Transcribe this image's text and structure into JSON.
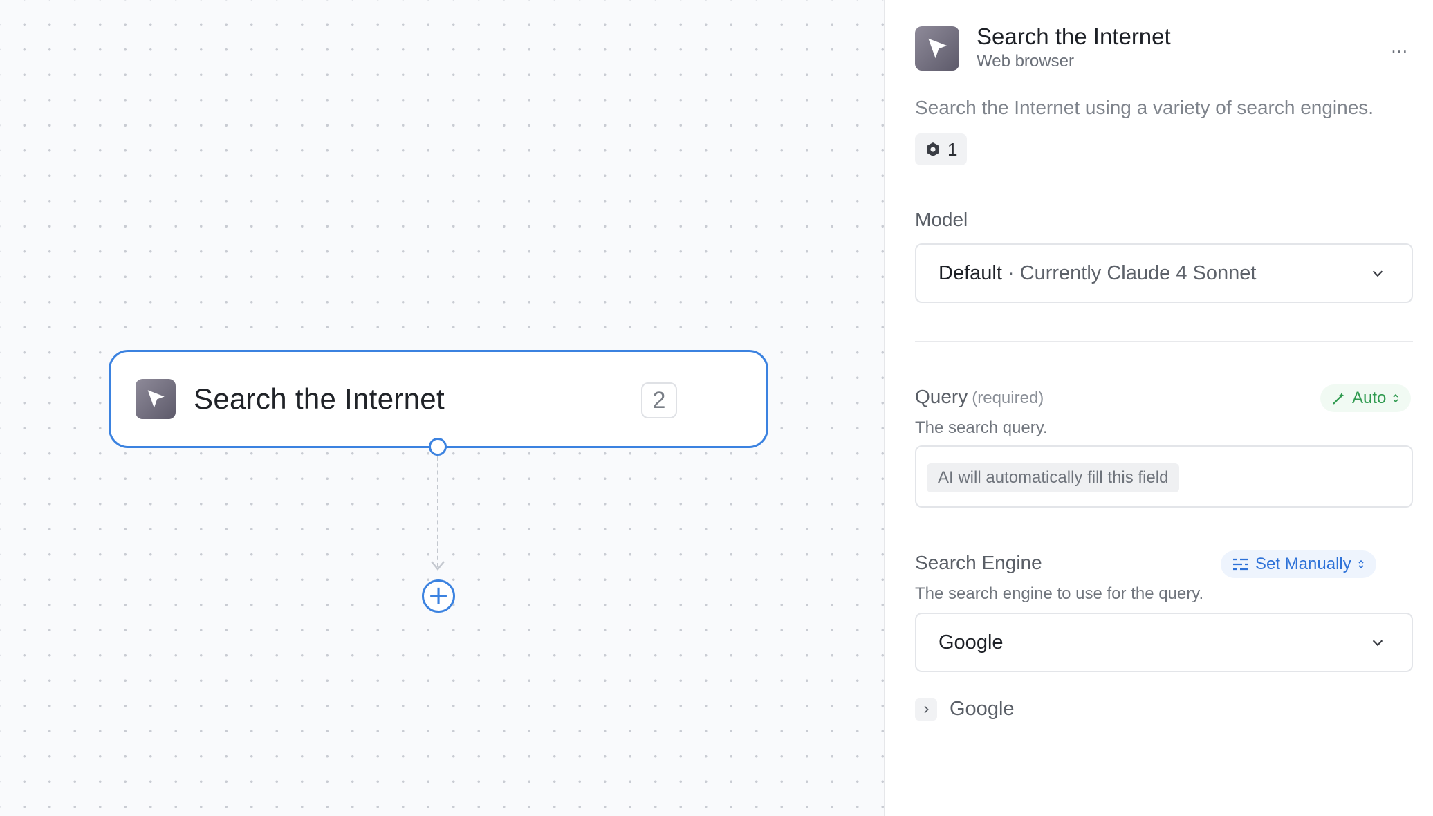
{
  "canvas": {
    "node": {
      "title": "Search the Internet",
      "badge": "2",
      "icon": "paper-plane-icon"
    },
    "add_button": "+"
  },
  "panel": {
    "title": "Search the Internet",
    "subtitle": "Web browser",
    "more": "...",
    "description": "Search the Internet using a variety of search engines.",
    "usage_count": "1",
    "model": {
      "label": "Model",
      "selected_main": "Default",
      "selected_detail": " · Currently Claude 4 Sonnet"
    },
    "query": {
      "label": "Query",
      "required": "(required)",
      "mode": "Auto",
      "hint": "The search query.",
      "placeholder": "AI will automatically fill this field"
    },
    "search_engine": {
      "label": "Search Engine",
      "mode": "Set Manually",
      "hint": "The search engine to use for the query.",
      "selected": "Google",
      "expander_label": "Google"
    }
  },
  "colors": {
    "accent": "#3b82e0",
    "auto_green": "#2f9a4f",
    "manual_blue": "#2e72d8"
  }
}
